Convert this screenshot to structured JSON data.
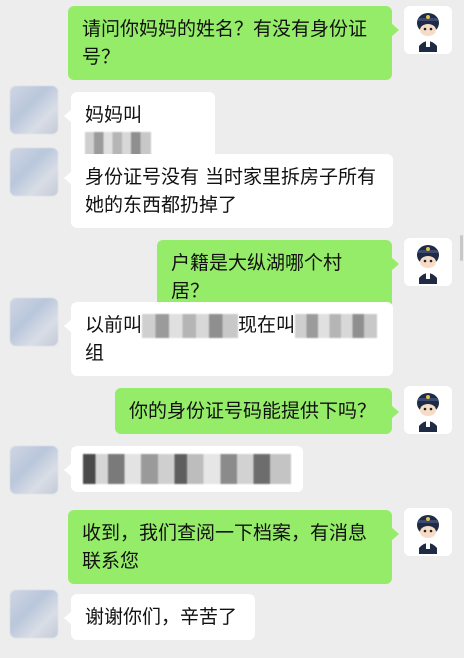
{
  "messages": [
    {
      "side": "out",
      "text": "请问你妈妈的姓名？有没有身份证号？"
    },
    {
      "side": "in",
      "text": "妈妈叫"
    },
    {
      "side": "in",
      "text": "身份证号没有 当时家里拆房子所有她的东西都扔掉了"
    },
    {
      "side": "out",
      "text": "户籍是大纵湖哪个村居？"
    },
    {
      "side": "in",
      "text_a": "以前叫",
      "text_b": "现在叫",
      "text_c": "组"
    },
    {
      "side": "out",
      "text": "你的身份证号码能提供下吗？"
    },
    {
      "side": "in",
      "text": ""
    },
    {
      "side": "out",
      "text": "收到，我们查阅一下档案，有消息联系您"
    },
    {
      "side": "in",
      "text": "谢谢你们，辛苦了"
    }
  ],
  "colors": {
    "background": "#ededed",
    "outgoing_bubble": "#95ec69",
    "incoming_bubble": "#ffffff"
  },
  "icons": {
    "police_avatar": "police-officer-avatar",
    "user_avatar": "blurred-user-avatar"
  }
}
